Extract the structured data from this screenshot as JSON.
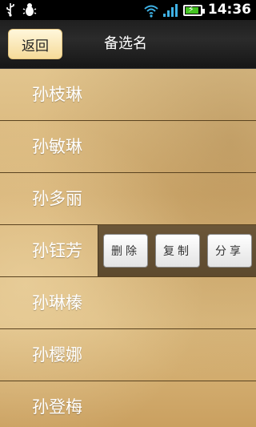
{
  "status_bar": {
    "time": "14:36",
    "icons": [
      "usb-icon",
      "debug-bug-icon",
      "wifi-icon",
      "signal-icon",
      "battery-charging-icon"
    ]
  },
  "header": {
    "back_label": "返回",
    "title": "备选名"
  },
  "list": {
    "items": [
      "孙枝琳",
      "孙敏琳",
      "孙多丽",
      "孙钰芳",
      "孙琳榛",
      "孙樱娜",
      "孙登梅"
    ]
  },
  "actions": {
    "delete_label": "删除",
    "copy_label": "复制",
    "share_label": "分享"
  },
  "colors": {
    "accent": "#f6db9a",
    "battery": "#44c322"
  }
}
